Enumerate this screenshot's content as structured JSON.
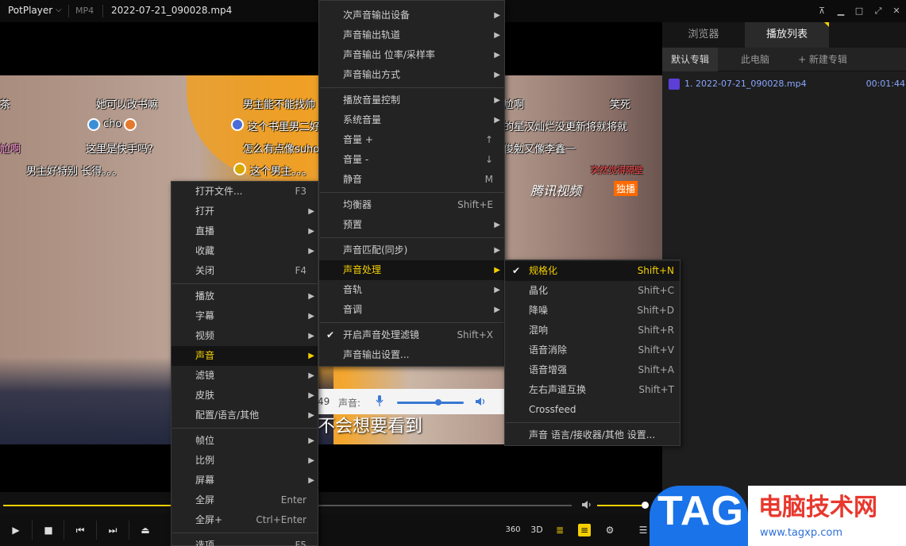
{
  "titlebar": {
    "app_name": "PotPlayer",
    "caret": "⌵",
    "format": "MP4",
    "filename": "2022-07-21_090028.mp4",
    "buttons": [
      "pin-icon",
      "minimize-icon",
      "restore-icon",
      "fullscreen-icon",
      "close-icon"
    ]
  },
  "video": {
    "danmaku": [
      "茶",
      "她可以改书嘛",
      "男主能不能找帅",
      "cho",
      "这个书里男二好",
      "尬啊",
      "这里是快手吗?",
      "怎么有点像suho",
      "男主好特别 长得。。。",
      "这个男主。。。",
      "尬啊",
      "笑死",
      "的星汉灿烂没更新将就将就",
      "俊勉又像李鑫一",
      "突然觉得隔壁"
    ],
    "watermark": "腾讯视频",
    "watermark_badge": "独播",
    "subtitle": "不会想要看到"
  },
  "volume_popup": {
    "time_fragment": "49",
    "label": "声音:"
  },
  "context_menu": {
    "items": [
      {
        "label": "打开文件...",
        "shortcut": "F3"
      },
      {
        "label": "打开",
        "submenu": true
      },
      {
        "label": "直播",
        "submenu": true
      },
      {
        "label": "收藏",
        "submenu": true
      },
      {
        "label": "关闭",
        "shortcut": "F4"
      },
      {
        "label": "播放",
        "submenu": true
      },
      {
        "label": "字幕",
        "submenu": true
      },
      {
        "label": "视频",
        "submenu": true
      },
      {
        "label": "声音",
        "submenu": true,
        "highlighted": true
      },
      {
        "label": "滤镜",
        "submenu": true
      },
      {
        "label": "皮肤",
        "submenu": true
      },
      {
        "label": "配置/语言/其他",
        "submenu": true
      },
      {
        "label": "帧位",
        "submenu": true
      },
      {
        "label": "比例",
        "submenu": true
      },
      {
        "label": "屏幕",
        "submenu": true
      },
      {
        "label": "全屏",
        "shortcut": "Enter"
      },
      {
        "label": "全屏+",
        "shortcut": "Ctrl+Enter"
      },
      {
        "label": "选项...",
        "shortcut": "F5"
      }
    ]
  },
  "sound_menu": {
    "items": [
      {
        "label": "次声音输出设备",
        "submenu": true
      },
      {
        "label": "声音输出轨道",
        "submenu": true
      },
      {
        "label": "声音输出 位率/采样率",
        "submenu": true
      },
      {
        "label": "声音输出方式",
        "submenu": true
      },
      {
        "label": "播放音量控制",
        "submenu": true
      },
      {
        "label": "系统音量",
        "submenu": true
      },
      {
        "label": "音量 +",
        "shortcut": "↑"
      },
      {
        "label": "音量 -",
        "shortcut": "↓"
      },
      {
        "label": "静音",
        "shortcut": "M"
      },
      {
        "label": "均衡器",
        "shortcut": "Shift+E"
      },
      {
        "label": "预置",
        "submenu": true
      },
      {
        "label": "声音匹配(同步)",
        "submenu": true
      },
      {
        "label": "声音处理",
        "submenu": true,
        "highlighted": true
      },
      {
        "label": "音轨",
        "submenu": true
      },
      {
        "label": "音调",
        "submenu": true
      },
      {
        "label": "开启声音处理滤镜",
        "shortcut": "Shift+X",
        "checked": true
      },
      {
        "label": "声音输出设置..."
      }
    ]
  },
  "processing_menu": {
    "items": [
      {
        "label": "规格化",
        "shortcut": "Shift+N",
        "checked": true,
        "highlighted": true
      },
      {
        "label": "晶化",
        "shortcut": "Shift+C"
      },
      {
        "label": "降噪",
        "shortcut": "Shift+D"
      },
      {
        "label": "混响",
        "shortcut": "Shift+R"
      },
      {
        "label": "语音消除",
        "shortcut": "Shift+V"
      },
      {
        "label": "语音增强",
        "shortcut": "Shift+A"
      },
      {
        "label": "左右声道互换",
        "shortcut": "Shift+T"
      },
      {
        "label": "Crossfeed"
      },
      {
        "label": "声音 语言/接收器/其他 设置..."
      }
    ]
  },
  "controls": {
    "buttons": [
      "play-icon",
      "stop-icon",
      "prev-icon",
      "next-icon",
      "eject-icon"
    ],
    "right_buttons": [
      "360",
      "3D",
      "playlist-search-icon",
      "subtitle-icon",
      "settings-icon",
      "menu-icon"
    ]
  },
  "playlist": {
    "tabs": [
      "浏览器",
      "播放列表"
    ],
    "active_tab": "播放列表",
    "subtabs": [
      "默认专辑",
      "此电脑",
      "+ 新建专辑"
    ],
    "items": [
      {
        "name": "1. 2022-07-21_090028.mp4",
        "duration": "00:01:44"
      }
    ]
  },
  "overlay_logo": {
    "tag": "TAG",
    "site_cn": "电脑技术网",
    "site_url": "www.tagxp.com"
  },
  "colors": {
    "accent": "#f5d000",
    "menu_bg": "#232323",
    "playlist_link": "#8aa6ff",
    "tag_blue": "#1a73e8",
    "site_red": "#e8382e"
  }
}
